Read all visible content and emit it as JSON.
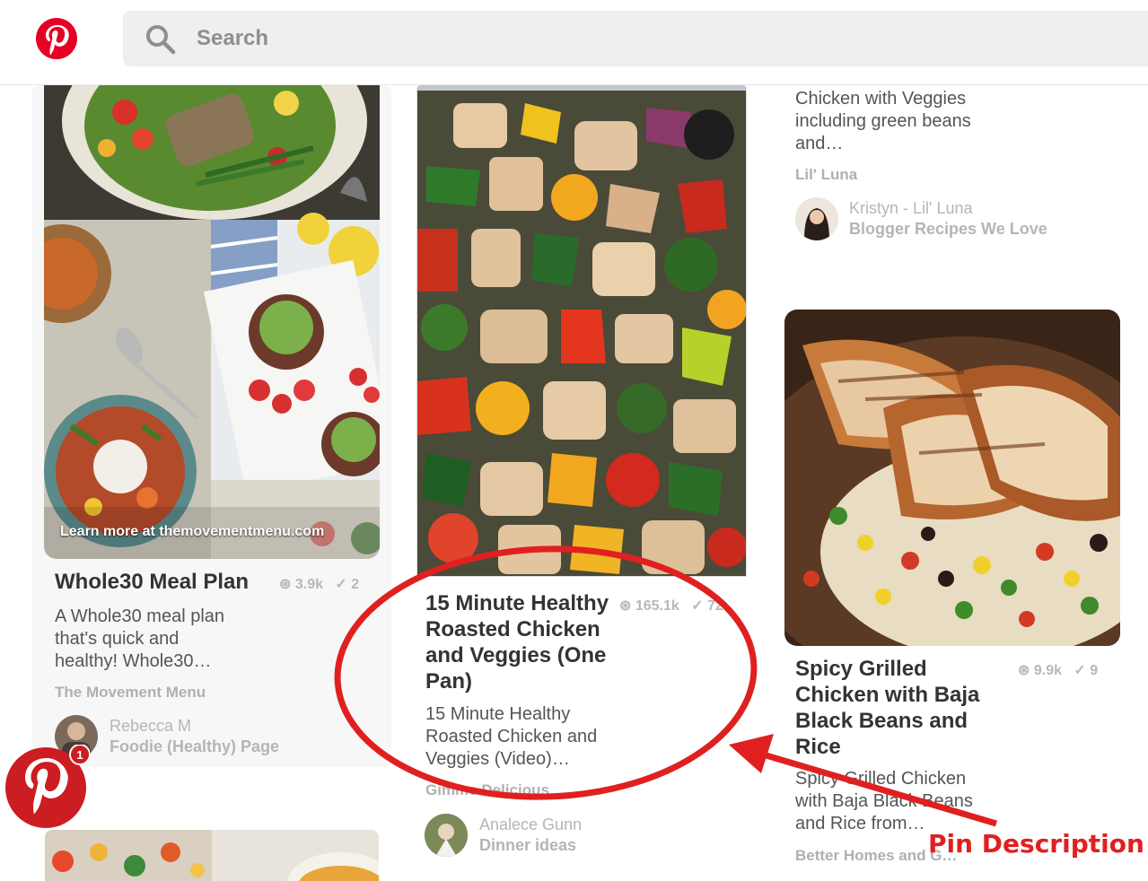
{
  "header": {
    "search_placeholder": "Search"
  },
  "pins": [
    {
      "title": "Whole30 Meal Plan",
      "saves": "3.9k",
      "comments": "2",
      "overlay": "Learn more at themovementmenu.com",
      "description": [
        "A Whole30 meal plan",
        "that's quick and",
        "healthy! Whole30…"
      ],
      "source": "The Movement Menu",
      "pinner": "Rebecca M",
      "board": "Foodie (Healthy) Page"
    },
    {
      "title": [
        "15 Minute Healthy",
        "Roasted Chicken",
        "and Veggies (One",
        "Pan)"
      ],
      "saves": "165.1k",
      "comments": "72",
      "description": [
        "15 Minute Healthy",
        "Roasted Chicken and",
        "Veggies (Video)…"
      ],
      "source": "Gimme Delicious",
      "pinner": "Analece Gunn",
      "board": "Dinner ideas"
    },
    {
      "description": [
        "Chicken with Veggies",
        "including green beans",
        "and…"
      ],
      "source": "Lil' Luna",
      "pinner": "Kristyn - Lil' Luna",
      "board": "Blogger Recipes We Love"
    },
    {
      "title": [
        "Spicy Grilled",
        "Chicken with Baja",
        "Black Beans and",
        "Rice"
      ],
      "saves": "9.9k",
      "comments": "9",
      "description": [
        "Spicy Grilled Chicken",
        "with Baja Black Beans",
        "and Rice from…"
      ],
      "source": "Better Homes and G…"
    }
  ],
  "notification_count": "1",
  "annotation": "Pin Description",
  "colors": {
    "brand": "#e60023",
    "annotation": "#e02020"
  }
}
